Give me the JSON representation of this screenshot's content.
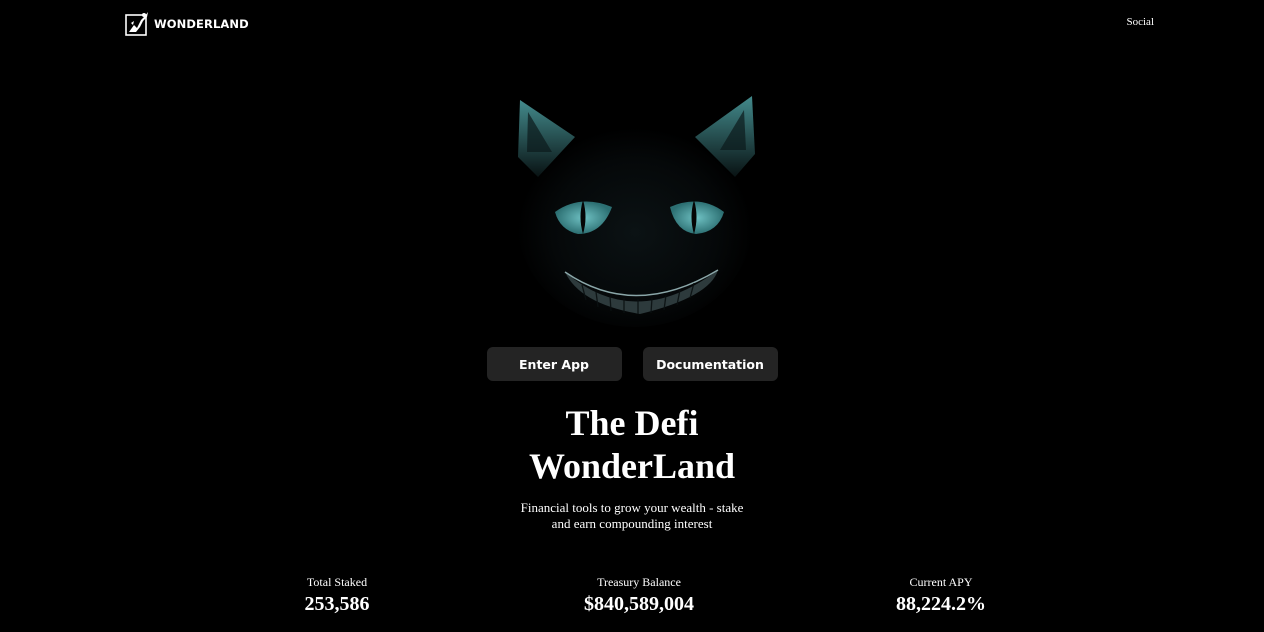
{
  "header": {
    "brand": "WONDERLAND",
    "nav_social": "Social",
    "logo_icon": "wonderland-logo-icon"
  },
  "hero": {
    "art_icon": "cheshire-cat-icon",
    "accent_color": "#4fa3a5",
    "buttons": {
      "enter_app": "Enter App",
      "documentation": "Documentation"
    },
    "title_line1": "The Defi",
    "title_line2": "WonderLand",
    "subtitle_line1": "Financial tools to grow your wealth - stake",
    "subtitle_line2": "and earn compounding interest"
  },
  "stats": [
    {
      "label": "Total Staked",
      "value": "253,586"
    },
    {
      "label": "Treasury Balance",
      "value": "$840,589,004"
    },
    {
      "label": "Current APY",
      "value": "88,224.2%"
    }
  ],
  "colors": {
    "background": "#000000",
    "button_bg": "#242424",
    "text": "#ffffff"
  }
}
